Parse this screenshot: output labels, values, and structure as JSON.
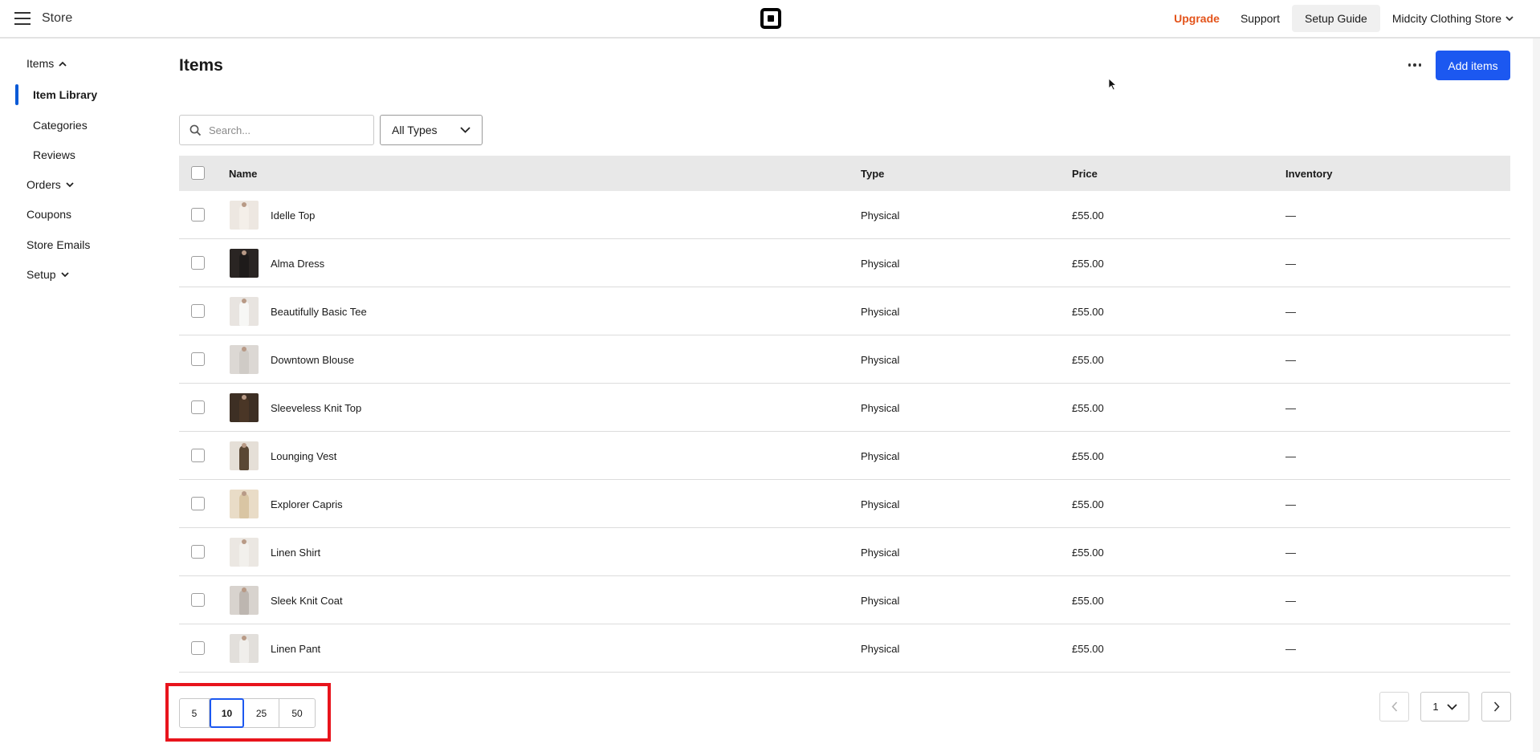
{
  "topbar": {
    "menu_icon": "hamburger-icon",
    "title": "Store",
    "logo_icon": "square-logo-icon",
    "upgrade": "Upgrade",
    "support": "Support",
    "setup_guide": "Setup Guide",
    "store_name": "Midcity Clothing Store",
    "accent_upgrade": "#e3531a"
  },
  "sidebar": {
    "items": "Items",
    "item_library": "Item Library",
    "categories": "Categories",
    "reviews": "Reviews",
    "orders": "Orders",
    "coupons": "Coupons",
    "store_emails": "Store Emails",
    "setup": "Setup",
    "active_color": "#0a5ad6"
  },
  "main": {
    "title": "Items",
    "more_icon": "more-horizontal-icon",
    "add_button": "Add items",
    "add_button_color": "#1c58f0",
    "search_placeholder": "Search...",
    "type_filter": "All Types"
  },
  "table": {
    "columns": {
      "name": "Name",
      "type": "Type",
      "price": "Price",
      "inventory": "Inventory"
    },
    "rows": [
      {
        "name": "Idelle Top",
        "type": "Physical",
        "price": "£55.00",
        "inventory": "—"
      },
      {
        "name": "Alma Dress",
        "type": "Physical",
        "price": "£55.00",
        "inventory": "—"
      },
      {
        "name": "Beautifully Basic Tee",
        "type": "Physical",
        "price": "£55.00",
        "inventory": "—"
      },
      {
        "name": "Downtown Blouse",
        "type": "Physical",
        "price": "£55.00",
        "inventory": "—"
      },
      {
        "name": "Sleeveless Knit Top",
        "type": "Physical",
        "price": "£55.00",
        "inventory": "—"
      },
      {
        "name": "Lounging Vest",
        "type": "Physical",
        "price": "£55.00",
        "inventory": "—"
      },
      {
        "name": "Explorer Capris",
        "type": "Physical",
        "price": "£55.00",
        "inventory": "—"
      },
      {
        "name": "Linen Shirt",
        "type": "Physical",
        "price": "£55.00",
        "inventory": "—"
      },
      {
        "name": "Sleek Knit Coat",
        "type": "Physical",
        "price": "£55.00",
        "inventory": "—"
      },
      {
        "name": "Linen Pant",
        "type": "Physical",
        "price": "£55.00",
        "inventory": "—"
      }
    ]
  },
  "pagination": {
    "sizes": [
      "5",
      "10",
      "25",
      "50"
    ],
    "selected_size": "10",
    "current_page": "1",
    "highlight_color": "#e8141c"
  }
}
